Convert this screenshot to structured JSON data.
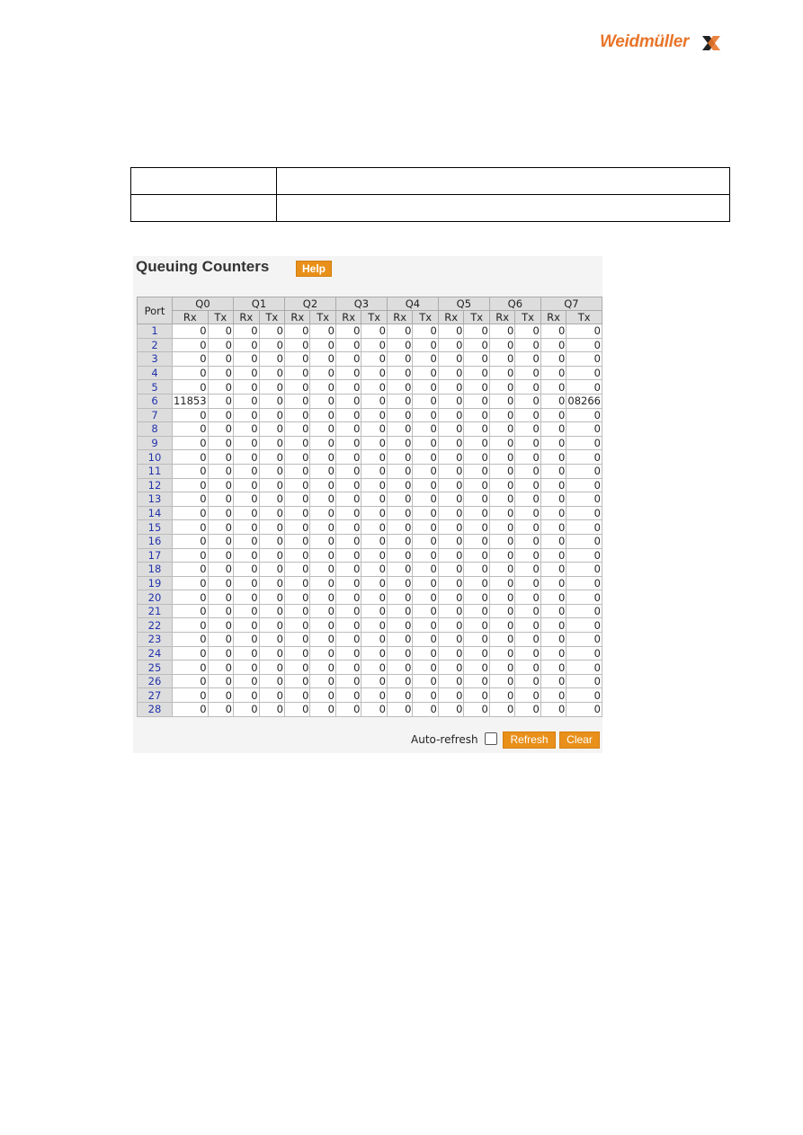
{
  "logo": {
    "text": "Weidmüller",
    "brand_color": "#e8752a"
  },
  "panel": {
    "title": "Queuing Counters",
    "help_label": "Help",
    "columns": {
      "port": "Port",
      "queues": [
        "Q0",
        "Q1",
        "Q2",
        "Q3",
        "Q4",
        "Q5",
        "Q6",
        "Q7"
      ],
      "sub": [
        "Rx",
        "Tx"
      ]
    },
    "rows": [
      {
        "port": "1",
        "values": [
          "0",
          "0",
          "0",
          "0",
          "0",
          "0",
          "0",
          "0",
          "0",
          "0",
          "0",
          "0",
          "0",
          "0",
          "0",
          "0"
        ]
      },
      {
        "port": "2",
        "values": [
          "0",
          "0",
          "0",
          "0",
          "0",
          "0",
          "0",
          "0",
          "0",
          "0",
          "0",
          "0",
          "0",
          "0",
          "0",
          "0"
        ]
      },
      {
        "port": "3",
        "values": [
          "0",
          "0",
          "0",
          "0",
          "0",
          "0",
          "0",
          "0",
          "0",
          "0",
          "0",
          "0",
          "0",
          "0",
          "0",
          "0"
        ]
      },
      {
        "port": "4",
        "values": [
          "0",
          "0",
          "0",
          "0",
          "0",
          "0",
          "0",
          "0",
          "0",
          "0",
          "0",
          "0",
          "0",
          "0",
          "0",
          "0"
        ]
      },
      {
        "port": "5",
        "values": [
          "0",
          "0",
          "0",
          "0",
          "0",
          "0",
          "0",
          "0",
          "0",
          "0",
          "0",
          "0",
          "0",
          "0",
          "0",
          "0"
        ]
      },
      {
        "port": "6",
        "values": [
          "11853",
          "0",
          "0",
          "0",
          "0",
          "0",
          "0",
          "0",
          "0",
          "0",
          "0",
          "0",
          "0",
          "0",
          "0",
          "08266"
        ]
      },
      {
        "port": "7",
        "values": [
          "0",
          "0",
          "0",
          "0",
          "0",
          "0",
          "0",
          "0",
          "0",
          "0",
          "0",
          "0",
          "0",
          "0",
          "0",
          "0"
        ]
      },
      {
        "port": "8",
        "values": [
          "0",
          "0",
          "0",
          "0",
          "0",
          "0",
          "0",
          "0",
          "0",
          "0",
          "0",
          "0",
          "0",
          "0",
          "0",
          "0"
        ]
      },
      {
        "port": "9",
        "values": [
          "0",
          "0",
          "0",
          "0",
          "0",
          "0",
          "0",
          "0",
          "0",
          "0",
          "0",
          "0",
          "0",
          "0",
          "0",
          "0"
        ]
      },
      {
        "port": "10",
        "values": [
          "0",
          "0",
          "0",
          "0",
          "0",
          "0",
          "0",
          "0",
          "0",
          "0",
          "0",
          "0",
          "0",
          "0",
          "0",
          "0"
        ]
      },
      {
        "port": "11",
        "values": [
          "0",
          "0",
          "0",
          "0",
          "0",
          "0",
          "0",
          "0",
          "0",
          "0",
          "0",
          "0",
          "0",
          "0",
          "0",
          "0"
        ]
      },
      {
        "port": "12",
        "values": [
          "0",
          "0",
          "0",
          "0",
          "0",
          "0",
          "0",
          "0",
          "0",
          "0",
          "0",
          "0",
          "0",
          "0",
          "0",
          "0"
        ]
      },
      {
        "port": "13",
        "values": [
          "0",
          "0",
          "0",
          "0",
          "0",
          "0",
          "0",
          "0",
          "0",
          "0",
          "0",
          "0",
          "0",
          "0",
          "0",
          "0"
        ]
      },
      {
        "port": "14",
        "values": [
          "0",
          "0",
          "0",
          "0",
          "0",
          "0",
          "0",
          "0",
          "0",
          "0",
          "0",
          "0",
          "0",
          "0",
          "0",
          "0"
        ]
      },
      {
        "port": "15",
        "values": [
          "0",
          "0",
          "0",
          "0",
          "0",
          "0",
          "0",
          "0",
          "0",
          "0",
          "0",
          "0",
          "0",
          "0",
          "0",
          "0"
        ]
      },
      {
        "port": "16",
        "values": [
          "0",
          "0",
          "0",
          "0",
          "0",
          "0",
          "0",
          "0",
          "0",
          "0",
          "0",
          "0",
          "0",
          "0",
          "0",
          "0"
        ]
      },
      {
        "port": "17",
        "values": [
          "0",
          "0",
          "0",
          "0",
          "0",
          "0",
          "0",
          "0",
          "0",
          "0",
          "0",
          "0",
          "0",
          "0",
          "0",
          "0"
        ]
      },
      {
        "port": "18",
        "values": [
          "0",
          "0",
          "0",
          "0",
          "0",
          "0",
          "0",
          "0",
          "0",
          "0",
          "0",
          "0",
          "0",
          "0",
          "0",
          "0"
        ]
      },
      {
        "port": "19",
        "values": [
          "0",
          "0",
          "0",
          "0",
          "0",
          "0",
          "0",
          "0",
          "0",
          "0",
          "0",
          "0",
          "0",
          "0",
          "0",
          "0"
        ]
      },
      {
        "port": "20",
        "values": [
          "0",
          "0",
          "0",
          "0",
          "0",
          "0",
          "0",
          "0",
          "0",
          "0",
          "0",
          "0",
          "0",
          "0",
          "0",
          "0"
        ]
      },
      {
        "port": "21",
        "values": [
          "0",
          "0",
          "0",
          "0",
          "0",
          "0",
          "0",
          "0",
          "0",
          "0",
          "0",
          "0",
          "0",
          "0",
          "0",
          "0"
        ]
      },
      {
        "port": "22",
        "values": [
          "0",
          "0",
          "0",
          "0",
          "0",
          "0",
          "0",
          "0",
          "0",
          "0",
          "0",
          "0",
          "0",
          "0",
          "0",
          "0"
        ]
      },
      {
        "port": "23",
        "values": [
          "0",
          "0",
          "0",
          "0",
          "0",
          "0",
          "0",
          "0",
          "0",
          "0",
          "0",
          "0",
          "0",
          "0",
          "0",
          "0"
        ]
      },
      {
        "port": "24",
        "values": [
          "0",
          "0",
          "0",
          "0",
          "0",
          "0",
          "0",
          "0",
          "0",
          "0",
          "0",
          "0",
          "0",
          "0",
          "0",
          "0"
        ]
      },
      {
        "port": "25",
        "values": [
          "0",
          "0",
          "0",
          "0",
          "0",
          "0",
          "0",
          "0",
          "0",
          "0",
          "0",
          "0",
          "0",
          "0",
          "0",
          "0"
        ]
      },
      {
        "port": "26",
        "values": [
          "0",
          "0",
          "0",
          "0",
          "0",
          "0",
          "0",
          "0",
          "0",
          "0",
          "0",
          "0",
          "0",
          "0",
          "0",
          "0"
        ]
      },
      {
        "port": "27",
        "values": [
          "0",
          "0",
          "0",
          "0",
          "0",
          "0",
          "0",
          "0",
          "0",
          "0",
          "0",
          "0",
          "0",
          "0",
          "0",
          "0"
        ]
      },
      {
        "port": "28",
        "values": [
          "0",
          "0",
          "0",
          "0",
          "0",
          "0",
          "0",
          "0",
          "0",
          "0",
          "0",
          "0",
          "0",
          "0",
          "0",
          "0"
        ]
      }
    ],
    "auto_refresh_label": "Auto-refresh",
    "auto_refresh_checked": false,
    "refresh_label": "Refresh",
    "clear_label": "Clear",
    "button_color": "#e8901a"
  }
}
